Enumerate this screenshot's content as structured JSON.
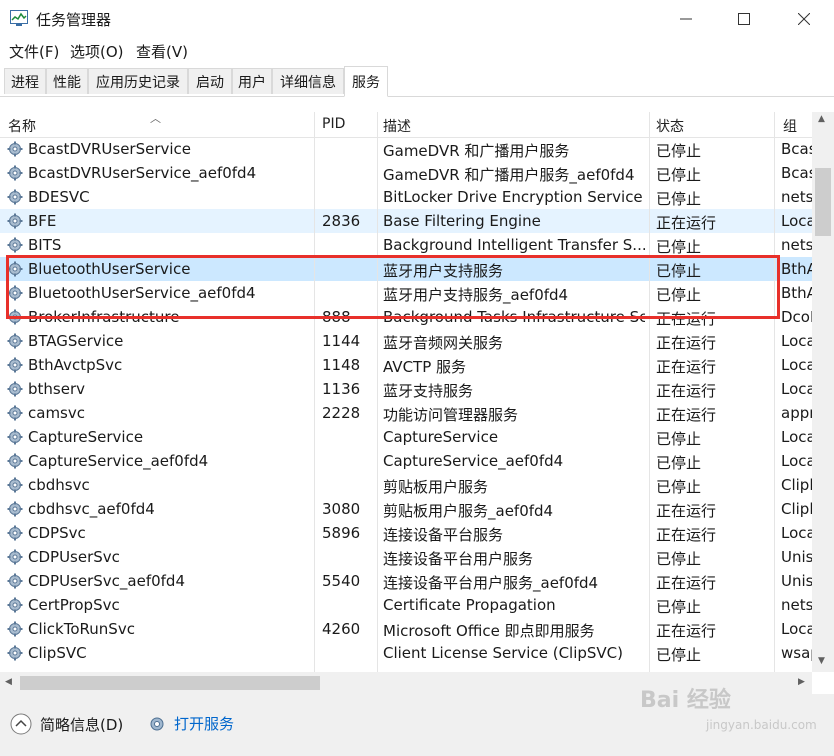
{
  "window": {
    "title": "任务管理器",
    "min_icon": "minimize-icon",
    "max_icon": "maximize-icon",
    "close_icon": "close-icon"
  },
  "menu": [
    "文件(F)",
    "选项(O)",
    "查看(V)"
  ],
  "tabs": [
    "进程",
    "性能",
    "应用历史记录",
    "启动",
    "用户",
    "详细信息",
    "服务"
  ],
  "active_tab": "服务",
  "columns": [
    "名称",
    "PID",
    "描述",
    "状态",
    "组"
  ],
  "rows": [
    {
      "name": "BcastDVRUserService",
      "pid": "",
      "desc": "GameDVR 和广播用户服务",
      "state": "已停止",
      "group": "Bcas"
    },
    {
      "name": "BcastDVRUserService_aef0fd4",
      "pid": "",
      "desc": "GameDVR 和广播用户服务_aef0fd4",
      "state": "已停止",
      "group": "Bcas"
    },
    {
      "name": "BDESVC",
      "pid": "",
      "desc": "BitLocker Drive Encryption Service",
      "state": "已停止",
      "group": "nets"
    },
    {
      "name": "BFE",
      "pid": "2836",
      "desc": "Base Filtering Engine",
      "state": "正在运行",
      "group": "Loca"
    },
    {
      "name": "BITS",
      "pid": "",
      "desc": "Background Intelligent Transfer S...",
      "state": "已停止",
      "group": "nets"
    },
    {
      "name": "BluetoothUserService",
      "pid": "",
      "desc": "蓝牙用户支持服务",
      "state": "已停止",
      "group": "BthA"
    },
    {
      "name": "BluetoothUserService_aef0fd4",
      "pid": "",
      "desc": "蓝牙用户支持服务_aef0fd4",
      "state": "已停止",
      "group": "BthA"
    },
    {
      "name": "BrokerInfrastructure",
      "pid": "888",
      "desc": "Background Tasks Infrastructure Se...",
      "state": "正在运行",
      "group": "DcoL"
    },
    {
      "name": "BTAGService",
      "pid": "1144",
      "desc": "蓝牙音频网关服务",
      "state": "正在运行",
      "group": "Loca"
    },
    {
      "name": "BthAvctpSvc",
      "pid": "1148",
      "desc": "AVCTP 服务",
      "state": "正在运行",
      "group": "Loca"
    },
    {
      "name": "bthserv",
      "pid": "1136",
      "desc": "蓝牙支持服务",
      "state": "正在运行",
      "group": "Loca"
    },
    {
      "name": "camsvc",
      "pid": "2228",
      "desc": "功能访问管理器服务",
      "state": "正在运行",
      "group": "appr"
    },
    {
      "name": "CaptureService",
      "pid": "",
      "desc": "CaptureService",
      "state": "已停止",
      "group": "Loca"
    },
    {
      "name": "CaptureService_aef0fd4",
      "pid": "",
      "desc": "CaptureService_aef0fd4",
      "state": "已停止",
      "group": "Loca"
    },
    {
      "name": "cbdhsvc",
      "pid": "",
      "desc": "剪贴板用户服务",
      "state": "已停止",
      "group": "Clipl"
    },
    {
      "name": "cbdhsvc_aef0fd4",
      "pid": "3080",
      "desc": "剪贴板用户服务_aef0fd4",
      "state": "正在运行",
      "group": "Clipl"
    },
    {
      "name": "CDPSvc",
      "pid": "5896",
      "desc": "连接设备平台服务",
      "state": "正在运行",
      "group": "Loca"
    },
    {
      "name": "CDPUserSvc",
      "pid": "",
      "desc": "连接设备平台用户服务",
      "state": "已停止",
      "group": "Unis"
    },
    {
      "name": "CDPUserSvc_aef0fd4",
      "pid": "5540",
      "desc": "连接设备平台用户服务_aef0fd4",
      "state": "正在运行",
      "group": "Unis"
    },
    {
      "name": "CertPropSvc",
      "pid": "",
      "desc": "Certificate Propagation",
      "state": "已停止",
      "group": "nets"
    },
    {
      "name": "ClickToRunSvc",
      "pid": "4260",
      "desc": "Microsoft Office 即点即用服务",
      "state": "正在运行",
      "group": "Loca"
    },
    {
      "name": "ClipSVC",
      "pid": "",
      "desc": "Client License Service (ClipSVC)",
      "state": "已停止",
      "group": "wsap"
    }
  ],
  "footer": {
    "fewer_details": "简略信息(D)",
    "open_services": "打开服务"
  },
  "watermark": {
    "brand": "Bai 经验",
    "url": "jingyan.baidu.com"
  },
  "colors": {
    "selected": "#cce8ff",
    "highlight_box": "#e8302a",
    "link": "#0066cc"
  }
}
